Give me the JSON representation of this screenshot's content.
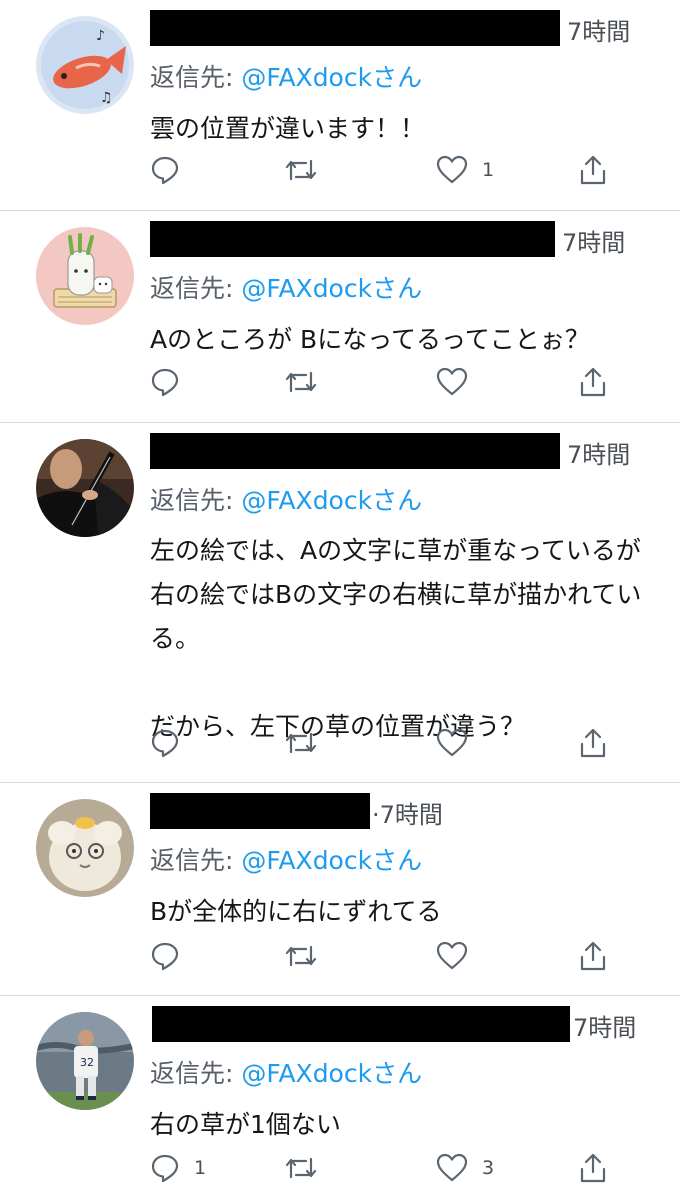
{
  "tweets": [
    {
      "time": "7時間",
      "reply_prefix": "返信先: ",
      "reply_handle": "@FAXdockさん",
      "text": "雲の位置が違います！！",
      "reply_count": "",
      "retweet_count": "",
      "like_count": "1",
      "avatar_icon": "fish-avatar"
    },
    {
      "time": "7時間",
      "reply_prefix": "返信先: ",
      "reply_handle": "@FAXdockさん",
      "text": "Aのところが Bになってるってことぉ？",
      "reply_count": "",
      "retweet_count": "",
      "like_count": "",
      "avatar_icon": "daikon-character-avatar"
    },
    {
      "time": "7時間",
      "reply_prefix": "返信先: ",
      "reply_handle": "@FAXdockさん",
      "text": "左の絵では、Aの文字に草が重なっているが\n右の絵ではBの文字の右横に草が描かれてい\nる。\n\nだから、左下の草の位置が違う？",
      "reply_count": "",
      "retweet_count": "",
      "like_count": "",
      "avatar_icon": "clarinet-player-avatar"
    },
    {
      "time": "·7時間",
      "reply_prefix": "返信先: ",
      "reply_handle": "@FAXdockさん",
      "text": "Bが全体的に右にずれてる",
      "reply_count": "",
      "retweet_count": "",
      "like_count": "",
      "avatar_icon": "plush-toy-avatar"
    },
    {
      "time": "7時間",
      "reply_prefix": "返信先: ",
      "reply_handle": "@FAXdockさん",
      "text": "右の草が1個ない",
      "reply_count": "1",
      "retweet_count": "",
      "like_count": "3",
      "avatar_icon": "baseball-player-avatar"
    }
  ],
  "icons": {
    "reply": "reply-icon",
    "retweet": "retweet-icon",
    "like": "heart-icon",
    "share": "share-icon"
  },
  "colors": {
    "handle": "#1d9bf0",
    "divider": "#d6d9dc",
    "action_icon": "#5b6570"
  }
}
